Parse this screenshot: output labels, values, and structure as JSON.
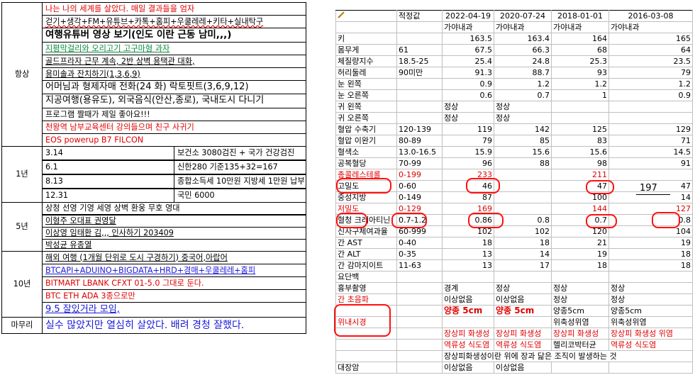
{
  "plan": {
    "always_label": "항상",
    "always_rows": [
      {
        "text": "나는 나의 세계를 살았다. 매일 결과들을 엄자",
        "style": "red"
      },
      {
        "text": "걷기+생각+FM+유튜브+카톡+홈피+우쿨레레+키타+실내탁구",
        "style": "wavy"
      },
      {
        "text": "여행유튜버 영상 보기(인도 이란 근동 남미,,,)",
        "style": "big"
      },
      {
        "text": "지평막걸리와 오리고기 고구마형 과자",
        "style": "green"
      },
      {
        "text": "골드프라자 근무 계속, 2반 상벽 용택관 대화,",
        "style": "u"
      },
      {
        "text": "용미솔과 잔치하기(1,3,6,9)",
        "style": "u"
      },
      {
        "text": "어머님과 형제자매 전화(24 화) 락토핏트(3,6,9,12)",
        "style": "big2"
      },
      {
        "text": "지공여행(용유도), 외국음식(안산,종로), 국내도시 다니기",
        "style": "big2"
      },
      {
        "text": "프로그램 짤때가 제일 좋아요!!!",
        "style": ""
      },
      {
        "text": "천왕역 남부교육센터 강의들으며 친구 사귀기",
        "style": "red"
      },
      {
        "text": "EOS powerup B7 FILCON",
        "style": "red"
      }
    ],
    "year_label": "1년",
    "year_rows": [
      {
        "date": "3.14",
        "text": "보건소 3080검진 + 국가 건강검진"
      },
      {
        "date": "",
        "text": ""
      },
      {
        "date": "6.1",
        "text": "신한280 기준135+32=167"
      },
      {
        "date": "",
        "text": ""
      },
      {
        "date": "8.13",
        "text": "종합소득세 10만원 지방세 1만원 납부"
      },
      {
        "date": "",
        "text": ""
      },
      {
        "date": "12.31",
        "text": "국민 6000"
      }
    ],
    "five_label": "5년",
    "five_rows": [
      {
        "text": "상청 선영 기영 세영 상벽  환웅 무호 영대"
      },
      {
        "text": ""
      },
      {
        "text": "이형주 오대표 권영달"
      },
      {
        "text": "이상영 임태환 김,,, 인사하기 203409"
      },
      {
        "text": "박성균 유종열"
      }
    ],
    "ten_label": "10년",
    "ten_rows": [
      {
        "text": "해외 여행 (1개월 단위로 도시 구경하기) 중국어,아랍어",
        "style": "mix1"
      },
      {
        "text": "BTCAPI+ADUINO+BIGDATA+HRD+경매+우쿨레레+홈피",
        "style": "blue"
      },
      {
        "text": "BITMART LBANK CFXT 01-5.0 그대로 둔다.",
        "style": "red"
      },
      {
        "text": "BTC ETH ADA 3종으로만",
        "style": "red"
      },
      {
        "text": "9.5 잘있거라 모임,",
        "style": "blue"
      }
    ],
    "closing_label": "마무리",
    "closing_text": "실수 많았지만 열심히 살았다. 배려 경청 잘했다."
  },
  "sheet": {
    "headers": [
      "",
      "적정값",
      "2022-04-19",
      "2020-07-24",
      "2018-01-01",
      "2016-03-08"
    ],
    "hospitals": [
      "가야내과",
      "가야내과",
      "가야내과",
      "가야내과"
    ],
    "rows": [
      [
        "키",
        "",
        "163.5",
        "163.4",
        "164",
        "165"
      ],
      [
        "몸무게",
        "61",
        "67.5",
        "66.3",
        "68",
        "64"
      ],
      [
        "체질량지수",
        "18.5-25",
        "25.4",
        "24.8",
        "25.3",
        "23.5"
      ],
      [
        "허리둘레",
        "90미만",
        "91.3",
        "88.7",
        "93",
        "79"
      ],
      [
        "눈 왼쪽",
        "",
        "0.9",
        "1.2",
        "1.2",
        "1.2"
      ],
      [
        "눈 오른쪽",
        "",
        "0.6",
        "0.7",
        "1",
        "0.9"
      ],
      [
        "귀 왼쪽",
        "",
        "정상",
        "정상",
        "",
        ""
      ],
      [
        "귀 오른쪽",
        "",
        "정상",
        "정상",
        "",
        ""
      ],
      [
        "혈압 수축기",
        "120-139",
        "119",
        "142",
        "125",
        "129"
      ],
      [
        "혈압 이완기",
        "80-89",
        "79",
        "85",
        "83",
        "71"
      ],
      [
        "혈색소",
        "13.0-16.5",
        "15.9",
        "15.6",
        "15.6",
        "14.5"
      ],
      [
        "공복혈당",
        "70-99",
        "96",
        "88",
        "98",
        "91"
      ],
      [
        "총콜레스테롤",
        "0-199",
        "233",
        "",
        "211",
        ""
      ],
      [
        "고밀도",
        "0-60",
        "46",
        "",
        "47",
        "47"
      ],
      [
        "중성지방",
        "0-149",
        "87",
        "",
        "100",
        "14"
      ],
      [
        "저밀도",
        "0-129",
        "169",
        "",
        "144",
        "127"
      ],
      [
        "혈청 크레아티닌",
        "0.7-1.2",
        "0.86",
        "0.8",
        "0.7",
        "0.8"
      ],
      [
        "신사구체여과율",
        "60-999",
        "102",
        "102",
        "120",
        "104"
      ],
      [
        "간 AST",
        "0-40",
        "18",
        "18",
        "21",
        "19"
      ],
      [
        "간 ALT",
        "0-35",
        "13",
        "14",
        "19",
        "18"
      ],
      [
        "간 감마지이트",
        "11-63",
        "13",
        "17",
        "18",
        "18"
      ],
      [
        "요단백",
        "",
        "",
        "",
        "",
        ""
      ],
      [
        "흉부촬영",
        "",
        "경계",
        "정상",
        "정상",
        "정상"
      ],
      [
        "간 초음파",
        "",
        "이상없음",
        "이상없음",
        "정상",
        "정상"
      ],
      [
        "",
        "",
        "양종 5cm",
        "양종 5cm",
        "양종5cm",
        "양종5cm"
      ],
      [
        "위내시경",
        "",
        "",
        "",
        "위축성위염",
        "위축성위염"
      ],
      [
        "",
        "",
        "장상피 화생성",
        "장상피 화생성",
        "장상피 화생성",
        "장상피 화생성 위염"
      ],
      [
        "",
        "",
        "역류성 식도염",
        "역류성 식도염",
        "헬리코박터균",
        "역류성 식도염"
      ],
      [
        "",
        "",
        "장상피화생성이란 위에 장과 닮은 조직이 발생하는 것",
        "",
        "",
        ""
      ],
      [
        "대장암",
        "",
        "이상없음",
        "이상없음",
        "",
        ""
      ]
    ],
    "note_197": "197"
  }
}
